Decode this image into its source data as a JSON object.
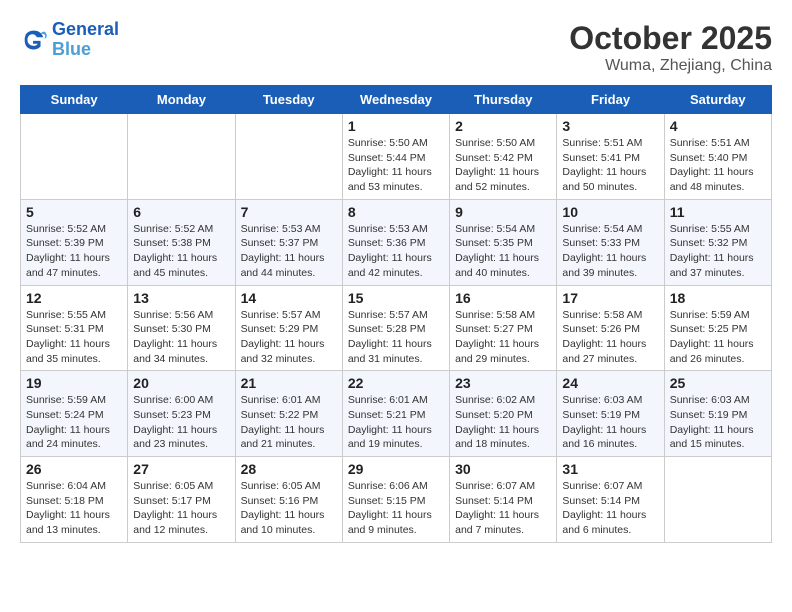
{
  "header": {
    "logo_line1": "General",
    "logo_line2": "Blue",
    "month": "October 2025",
    "location": "Wuma, Zhejiang, China"
  },
  "weekdays": [
    "Sunday",
    "Monday",
    "Tuesday",
    "Wednesday",
    "Thursday",
    "Friday",
    "Saturday"
  ],
  "weeks": [
    [
      {
        "day": "",
        "info": ""
      },
      {
        "day": "",
        "info": ""
      },
      {
        "day": "",
        "info": ""
      },
      {
        "day": "1",
        "info": "Sunrise: 5:50 AM\nSunset: 5:44 PM\nDaylight: 11 hours\nand 53 minutes."
      },
      {
        "day": "2",
        "info": "Sunrise: 5:50 AM\nSunset: 5:42 PM\nDaylight: 11 hours\nand 52 minutes."
      },
      {
        "day": "3",
        "info": "Sunrise: 5:51 AM\nSunset: 5:41 PM\nDaylight: 11 hours\nand 50 minutes."
      },
      {
        "day": "4",
        "info": "Sunrise: 5:51 AM\nSunset: 5:40 PM\nDaylight: 11 hours\nand 48 minutes."
      }
    ],
    [
      {
        "day": "5",
        "info": "Sunrise: 5:52 AM\nSunset: 5:39 PM\nDaylight: 11 hours\nand 47 minutes."
      },
      {
        "day": "6",
        "info": "Sunrise: 5:52 AM\nSunset: 5:38 PM\nDaylight: 11 hours\nand 45 minutes."
      },
      {
        "day": "7",
        "info": "Sunrise: 5:53 AM\nSunset: 5:37 PM\nDaylight: 11 hours\nand 44 minutes."
      },
      {
        "day": "8",
        "info": "Sunrise: 5:53 AM\nSunset: 5:36 PM\nDaylight: 11 hours\nand 42 minutes."
      },
      {
        "day": "9",
        "info": "Sunrise: 5:54 AM\nSunset: 5:35 PM\nDaylight: 11 hours\nand 40 minutes."
      },
      {
        "day": "10",
        "info": "Sunrise: 5:54 AM\nSunset: 5:33 PM\nDaylight: 11 hours\nand 39 minutes."
      },
      {
        "day": "11",
        "info": "Sunrise: 5:55 AM\nSunset: 5:32 PM\nDaylight: 11 hours\nand 37 minutes."
      }
    ],
    [
      {
        "day": "12",
        "info": "Sunrise: 5:55 AM\nSunset: 5:31 PM\nDaylight: 11 hours\nand 35 minutes."
      },
      {
        "day": "13",
        "info": "Sunrise: 5:56 AM\nSunset: 5:30 PM\nDaylight: 11 hours\nand 34 minutes."
      },
      {
        "day": "14",
        "info": "Sunrise: 5:57 AM\nSunset: 5:29 PM\nDaylight: 11 hours\nand 32 minutes."
      },
      {
        "day": "15",
        "info": "Sunrise: 5:57 AM\nSunset: 5:28 PM\nDaylight: 11 hours\nand 31 minutes."
      },
      {
        "day": "16",
        "info": "Sunrise: 5:58 AM\nSunset: 5:27 PM\nDaylight: 11 hours\nand 29 minutes."
      },
      {
        "day": "17",
        "info": "Sunrise: 5:58 AM\nSunset: 5:26 PM\nDaylight: 11 hours\nand 27 minutes."
      },
      {
        "day": "18",
        "info": "Sunrise: 5:59 AM\nSunset: 5:25 PM\nDaylight: 11 hours\nand 26 minutes."
      }
    ],
    [
      {
        "day": "19",
        "info": "Sunrise: 5:59 AM\nSunset: 5:24 PM\nDaylight: 11 hours\nand 24 minutes."
      },
      {
        "day": "20",
        "info": "Sunrise: 6:00 AM\nSunset: 5:23 PM\nDaylight: 11 hours\nand 23 minutes."
      },
      {
        "day": "21",
        "info": "Sunrise: 6:01 AM\nSunset: 5:22 PM\nDaylight: 11 hours\nand 21 minutes."
      },
      {
        "day": "22",
        "info": "Sunrise: 6:01 AM\nSunset: 5:21 PM\nDaylight: 11 hours\nand 19 minutes."
      },
      {
        "day": "23",
        "info": "Sunrise: 6:02 AM\nSunset: 5:20 PM\nDaylight: 11 hours\nand 18 minutes."
      },
      {
        "day": "24",
        "info": "Sunrise: 6:03 AM\nSunset: 5:19 PM\nDaylight: 11 hours\nand 16 minutes."
      },
      {
        "day": "25",
        "info": "Sunrise: 6:03 AM\nSunset: 5:19 PM\nDaylight: 11 hours\nand 15 minutes."
      }
    ],
    [
      {
        "day": "26",
        "info": "Sunrise: 6:04 AM\nSunset: 5:18 PM\nDaylight: 11 hours\nand 13 minutes."
      },
      {
        "day": "27",
        "info": "Sunrise: 6:05 AM\nSunset: 5:17 PM\nDaylight: 11 hours\nand 12 minutes."
      },
      {
        "day": "28",
        "info": "Sunrise: 6:05 AM\nSunset: 5:16 PM\nDaylight: 11 hours\nand 10 minutes."
      },
      {
        "day": "29",
        "info": "Sunrise: 6:06 AM\nSunset: 5:15 PM\nDaylight: 11 hours\nand 9 minutes."
      },
      {
        "day": "30",
        "info": "Sunrise: 6:07 AM\nSunset: 5:14 PM\nDaylight: 11 hours\nand 7 minutes."
      },
      {
        "day": "31",
        "info": "Sunrise: 6:07 AM\nSunset: 5:14 PM\nDaylight: 11 hours\nand 6 minutes."
      },
      {
        "day": "",
        "info": ""
      }
    ]
  ]
}
